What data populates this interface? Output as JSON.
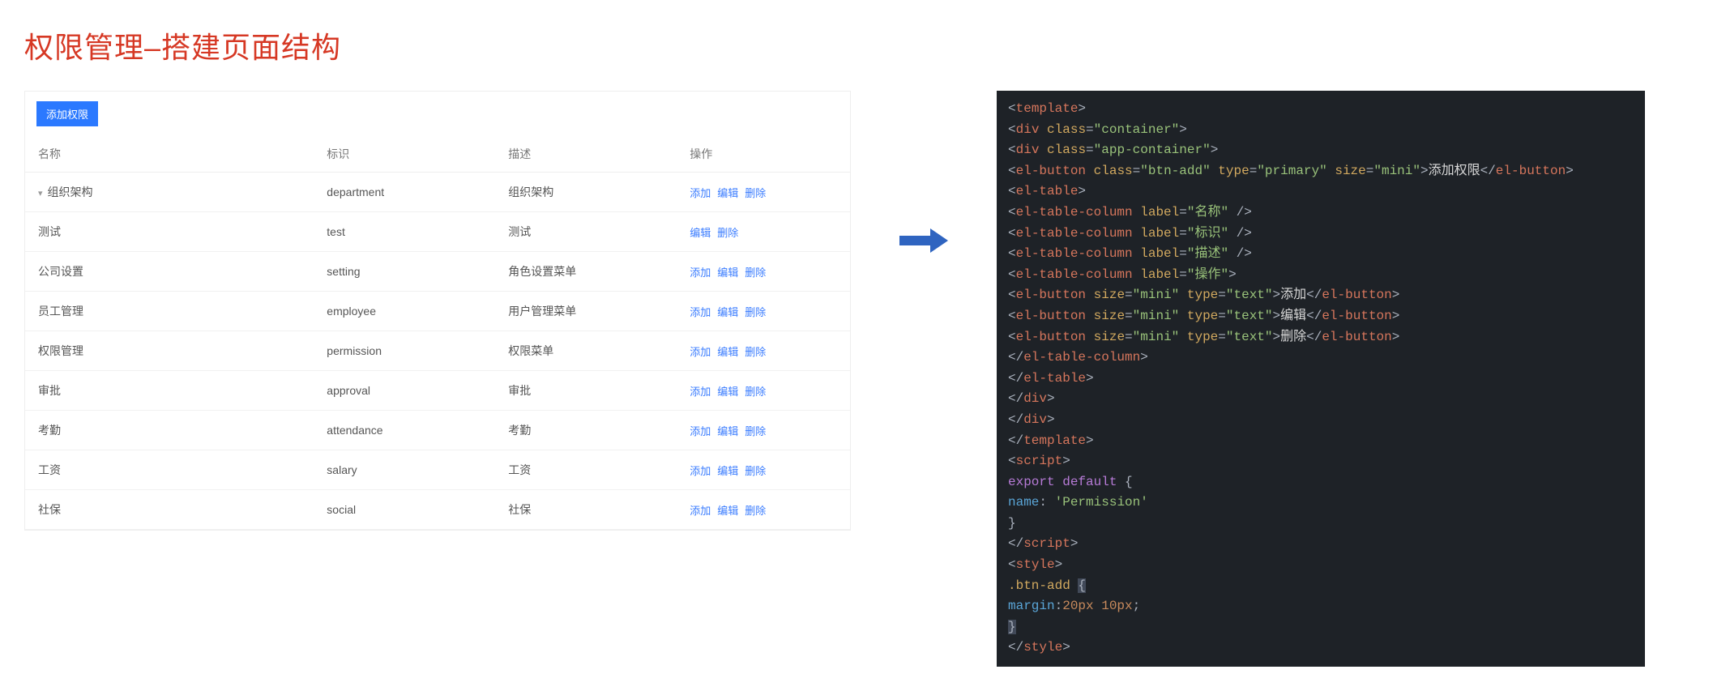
{
  "title": "权限管理–搭建页面结构",
  "addButton": "添加权限",
  "table": {
    "headers": [
      "名称",
      "标识",
      "描述",
      "操作"
    ],
    "actions": {
      "add": "添加",
      "edit": "编辑",
      "delete": "删除"
    },
    "rows": [
      {
        "name": "组织架构",
        "key": "department",
        "desc": "组织架构",
        "expand": true,
        "indent": 0,
        "acts": [
          "add",
          "edit",
          "delete"
        ]
      },
      {
        "name": "测试",
        "key": "test",
        "desc": "测试",
        "expand": false,
        "indent": 1,
        "acts": [
          "edit",
          "delete"
        ]
      },
      {
        "name": "公司设置",
        "key": "setting",
        "desc": "角色设置菜单",
        "expand": false,
        "indent": 0,
        "acts": [
          "add",
          "edit",
          "delete"
        ]
      },
      {
        "name": "员工管理",
        "key": "employee",
        "desc": "用户管理菜单",
        "expand": false,
        "indent": 0,
        "acts": [
          "add",
          "edit",
          "delete"
        ]
      },
      {
        "name": "权限管理",
        "key": "permission",
        "desc": "权限菜单",
        "expand": false,
        "indent": 0,
        "acts": [
          "add",
          "edit",
          "delete"
        ]
      },
      {
        "name": "审批",
        "key": "approval",
        "desc": "审批",
        "expand": false,
        "indent": 0,
        "acts": [
          "add",
          "edit",
          "delete"
        ]
      },
      {
        "name": "考勤",
        "key": "attendance",
        "desc": "考勤",
        "expand": false,
        "indent": 0,
        "acts": [
          "add",
          "edit",
          "delete"
        ]
      },
      {
        "name": "工资",
        "key": "salary",
        "desc": "工资",
        "expand": false,
        "indent": 0,
        "acts": [
          "add",
          "edit",
          "delete"
        ]
      },
      {
        "name": "社保",
        "key": "social",
        "desc": "社保",
        "expand": false,
        "indent": 0,
        "acts": [
          "add",
          "edit",
          "delete"
        ]
      }
    ]
  },
  "code": {
    "templateOpen": "template",
    "templateClose": "template",
    "divOpen": "div",
    "divClose": "div",
    "classAttr": "class",
    "container": "\"container\"",
    "appContainer": "\"app-container\"",
    "elButton": "el-button",
    "elTable": "el-table",
    "elTableColumn": "el-table-column",
    "btnAddClass": "\"btn-add\"",
    "typeAttr": "type",
    "primary": "\"primary\"",
    "sizeAttr": "size",
    "mini": "\"mini\"",
    "textType": "\"text\"",
    "labelAttr": "label",
    "labelName": "\"名称\"",
    "labelKey": "\"标识\"",
    "labelDesc": "\"描述\"",
    "labelOps": "\"操作\"",
    "btnAddText": "添加权限",
    "btnAdd": "添加",
    "btnEdit": "编辑",
    "btnDel": "删除",
    "scriptTag": "script",
    "styleTag": "style",
    "export": "export",
    "default": "default",
    "nameKey": "name",
    "permission": "'Permission'",
    "btnAddSel": ".btn-add",
    "margin": "margin",
    "marginVal": "20px 10px"
  }
}
